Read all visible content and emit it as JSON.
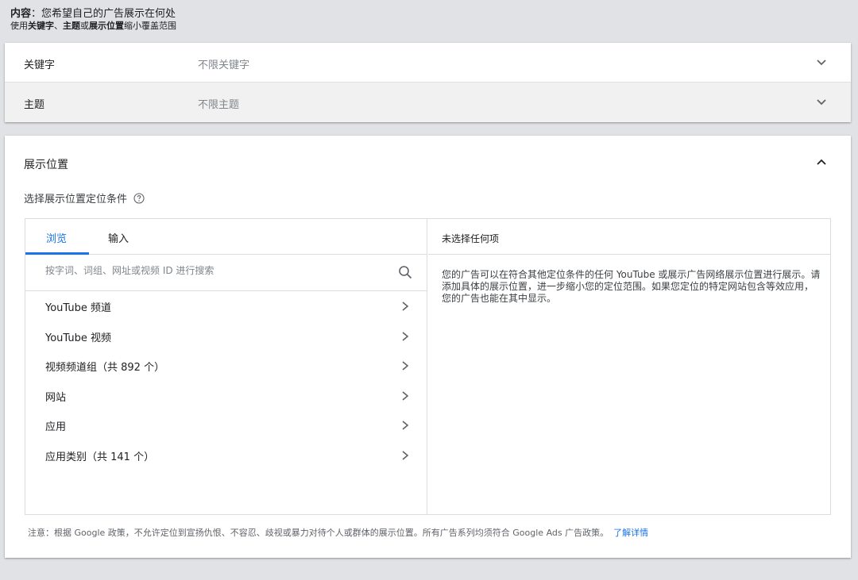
{
  "header": {
    "label_bold": "内容",
    "label_rest": "：您希望自己的广告展示在何处",
    "sub_prefix": "使用",
    "sub_kw": "关键字",
    "sub_sep": "、",
    "sub_topic": "主题",
    "sub_or": "或",
    "sub_place": "展示位置",
    "sub_suffix": "缩小覆盖范围"
  },
  "keywords": {
    "label": "关键字",
    "value": "不限关键字",
    "icon": "chevron-down-icon"
  },
  "topics": {
    "label": "主题",
    "value": "不限主题",
    "icon": "chevron-down-icon"
  },
  "placements": {
    "title": "展示位置",
    "subtitle": "选择展示位置定位条件",
    "tabs": [
      {
        "label": "浏览"
      },
      {
        "label": "输入"
      }
    ],
    "search_placeholder": "按字词、词组、网址或视频 ID 进行搜索",
    "items": [
      {
        "label": "YouTube 频道"
      },
      {
        "label": "YouTube 视频"
      },
      {
        "label": "视频频道组（共 892 个）"
      },
      {
        "label": "网站"
      },
      {
        "label": "应用"
      },
      {
        "label": "应用类别（共 141 个）"
      }
    ],
    "right_header": "未选择任何项",
    "right_body": "您的广告可以在符合其他定位条件的任何 YouTube 或展示广告网络展示位置进行展示。请添加具体的展示位置，进一步缩小您的定位范围。如果您定位的特定网站包含等效应用，您的广告也能在其中显示。",
    "note": "注意：根据 Google 政策，不允许定位到宣扬仇恨、不容忍、歧视或暴力对待个人或群体的展示位置。所有广告系列均须符合 Google Ads 广告政策。",
    "note_link": "了解详情"
  },
  "colors": {
    "accent": "#1a73e8",
    "background": "#e1e2e5"
  }
}
